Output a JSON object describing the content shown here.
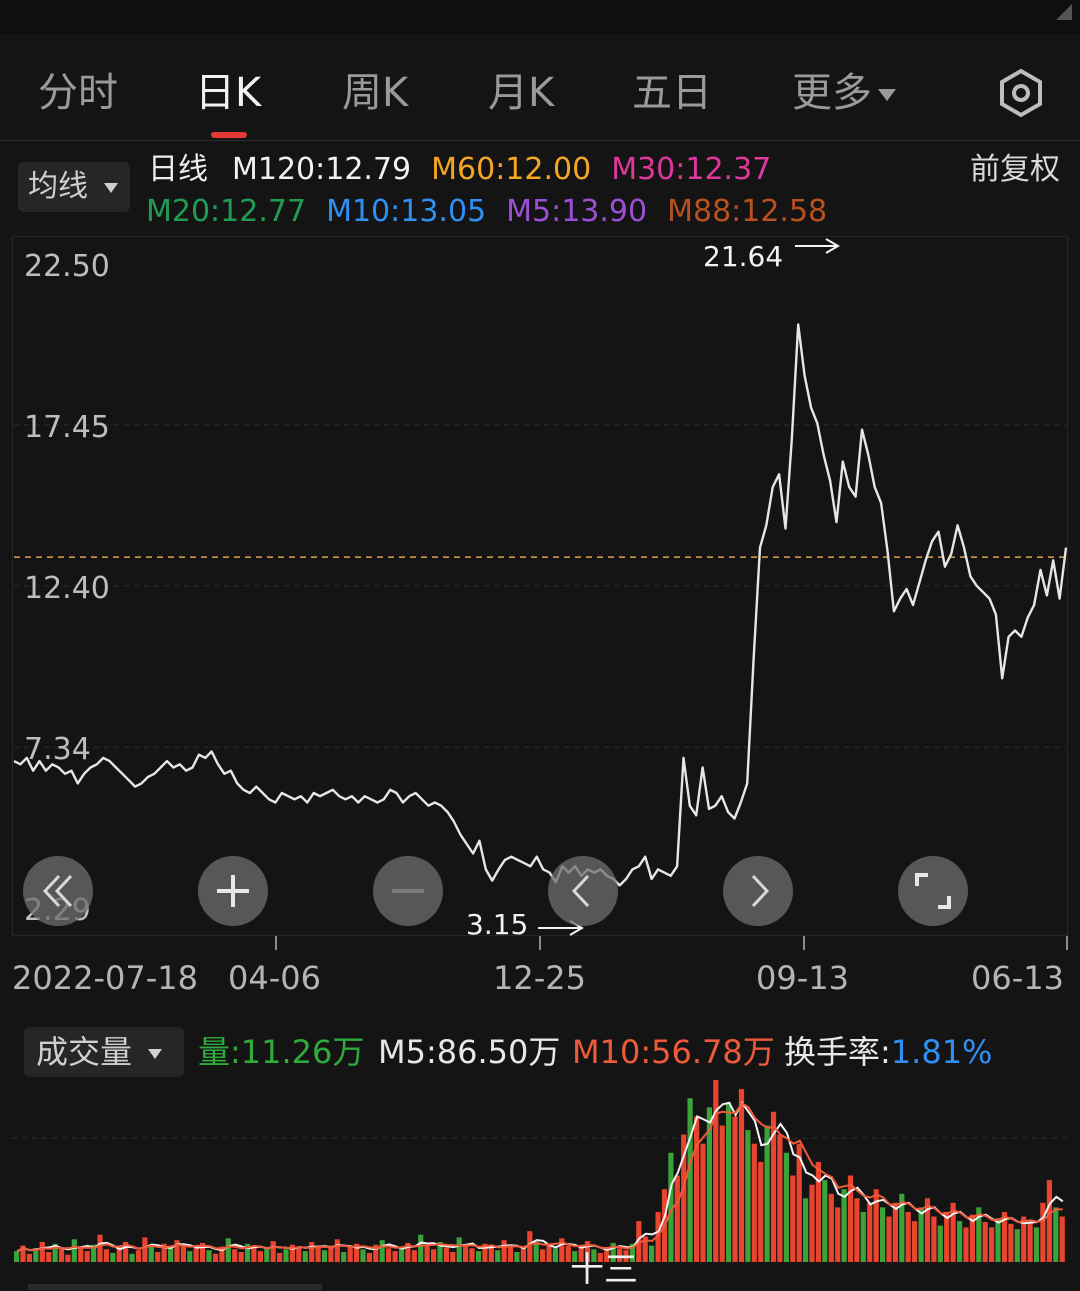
{
  "tabs": [
    {
      "label": "分时"
    },
    {
      "label": "日K"
    },
    {
      "label": "周K"
    },
    {
      "label": "月K"
    },
    {
      "label": "五日"
    }
  ],
  "more_label": "更多",
  "ma_button": "均线",
  "period_label": "日线",
  "ma_line1": [
    {
      "label": "M120:12.79",
      "color": "#f0f0f0"
    },
    {
      "label": "M60:12.00",
      "color": "#f5a623"
    },
    {
      "label": "M30:12.37",
      "color": "#e0379a"
    }
  ],
  "ma_line2": [
    {
      "label": "M20:12.77",
      "color": "#1f9d55"
    },
    {
      "label": "M10:13.05",
      "color": "#2f8ff2"
    },
    {
      "label": "M5:13.90",
      "color": "#9b4fd6"
    },
    {
      "label": "M88:12.58",
      "color": "#b8501f"
    }
  ],
  "adjust_label": "前复权",
  "high_annotation": "21.64",
  "low_annotation": "3.15",
  "chart_data": {
    "type": "line",
    "y_ticks": [
      "22.50",
      "17.45",
      "12.40",
      "7.34",
      "2.29"
    ],
    "ylim": [
      2.29,
      22.5
    ],
    "reference_line": 13.3,
    "dates": [
      "2022-07-18",
      "04-06",
      "12-25",
      "09-13",
      "06-13"
    ],
    "close": [
      6.9,
      6.8,
      7.0,
      6.6,
      6.9,
      6.6,
      6.8,
      6.7,
      6.5,
      6.6,
      6.2,
      6.5,
      6.7,
      6.8,
      7.0,
      6.9,
      6.7,
      6.5,
      6.3,
      6.1,
      6.2,
      6.4,
      6.5,
      6.7,
      6.9,
      6.7,
      6.8,
      6.6,
      6.7,
      7.1,
      7.0,
      7.2,
      6.8,
      6.5,
      6.6,
      6.2,
      6.0,
      5.9,
      6.1,
      5.9,
      5.7,
      5.6,
      5.9,
      5.8,
      5.7,
      5.8,
      5.6,
      5.9,
      5.8,
      5.9,
      6.0,
      5.8,
      5.7,
      5.8,
      5.6,
      5.8,
      5.7,
      5.6,
      5.7,
      6.0,
      5.9,
      5.6,
      5.8,
      5.9,
      5.7,
      5.5,
      5.6,
      5.5,
      5.3,
      5.0,
      4.6,
      4.3,
      4.0,
      4.4,
      3.5,
      3.15,
      3.5,
      3.8,
      3.9,
      3.8,
      3.7,
      3.6,
      3.9,
      3.5,
      3.4,
      3.1,
      3.6,
      3.4,
      3.6,
      3.3,
      3.5,
      3.4,
      3.5,
      3.3,
      3.2,
      3.0,
      3.2,
      3.5,
      3.6,
      3.9,
      3.2,
      3.5,
      3.4,
      3.3,
      3.6,
      7.0,
      5.5,
      5.2,
      6.7,
      5.4,
      5.5,
      5.8,
      5.3,
      5.1,
      5.6,
      6.2,
      10.1,
      13.6,
      14.3,
      15.5,
      15.9,
      14.2,
      17.0,
      20.6,
      19.0,
      18.0,
      17.5,
      16.5,
      15.7,
      14.4,
      16.3,
      15.5,
      15.2,
      17.3,
      16.5,
      15.5,
      15.0,
      13.5,
      11.6,
      12.0,
      12.3,
      11.8,
      12.5,
      13.2,
      13.8,
      14.1,
      13.0,
      13.4,
      14.3,
      13.6,
      12.7,
      12.4,
      12.2,
      12.0,
      11.5,
      9.5,
      10.8,
      11.0,
      10.8,
      11.4,
      11.8,
      12.9,
      12.1,
      13.2,
      12.0,
      13.6
    ]
  },
  "volume_button": "成交量",
  "volume_stats": [
    {
      "label": "量:11.26万",
      "color": "#2faa3c"
    },
    {
      "label": "M5:86.50万",
      "color": "#e8e8e8"
    },
    {
      "label": "M10:56.78万",
      "color": "#ef5a3a"
    }
  ],
  "turnover_label": "换手率:",
  "turnover_value": "1.81%",
  "turnover_label_color": "#e8e8e8",
  "turnover_value_color": "#2f8ff2",
  "volume_data": {
    "values_wan": [
      12,
      18,
      9,
      15,
      22,
      11,
      20,
      14,
      8,
      25,
      16,
      12,
      19,
      30,
      14,
      10,
      18,
      22,
      9,
      13,
      27,
      17,
      11,
      20,
      15,
      24,
      19,
      12,
      16,
      21,
      13,
      9,
      17,
      26,
      14,
      11,
      20,
      18,
      12,
      15,
      23,
      10,
      14,
      19,
      16,
      12,
      22,
      17,
      13,
      18,
      25,
      11,
      16,
      20,
      14,
      10,
      19,
      24,
      15,
      12,
      17,
      21,
      13,
      30,
      18,
      14,
      22,
      16,
      11,
      27,
      19,
      15,
      12,
      20,
      17,
      13,
      24,
      18,
      11,
      16,
      34,
      22,
      14,
      19,
      15,
      26,
      18,
      12,
      17,
      23,
      14,
      10,
      16,
      21,
      15,
      13,
      20,
      45,
      28,
      18,
      55,
      80,
      120,
      95,
      140,
      180,
      160,
      130,
      170,
      200,
      150,
      175,
      160,
      190,
      145,
      130,
      110,
      150,
      165,
      140,
      120,
      95,
      130,
      70,
      85,
      110,
      90,
      75,
      60,
      80,
      95,
      70,
      55,
      65,
      80,
      60,
      50,
      65,
      75,
      55,
      45,
      60,
      70,
      50,
      40,
      55,
      65,
      45,
      38,
      52,
      60,
      44,
      38,
      48,
      55,
      42,
      36,
      50,
      44,
      38,
      65,
      90,
      60,
      50
    ],
    "unit": "万"
  },
  "bottom_text": "十三"
}
